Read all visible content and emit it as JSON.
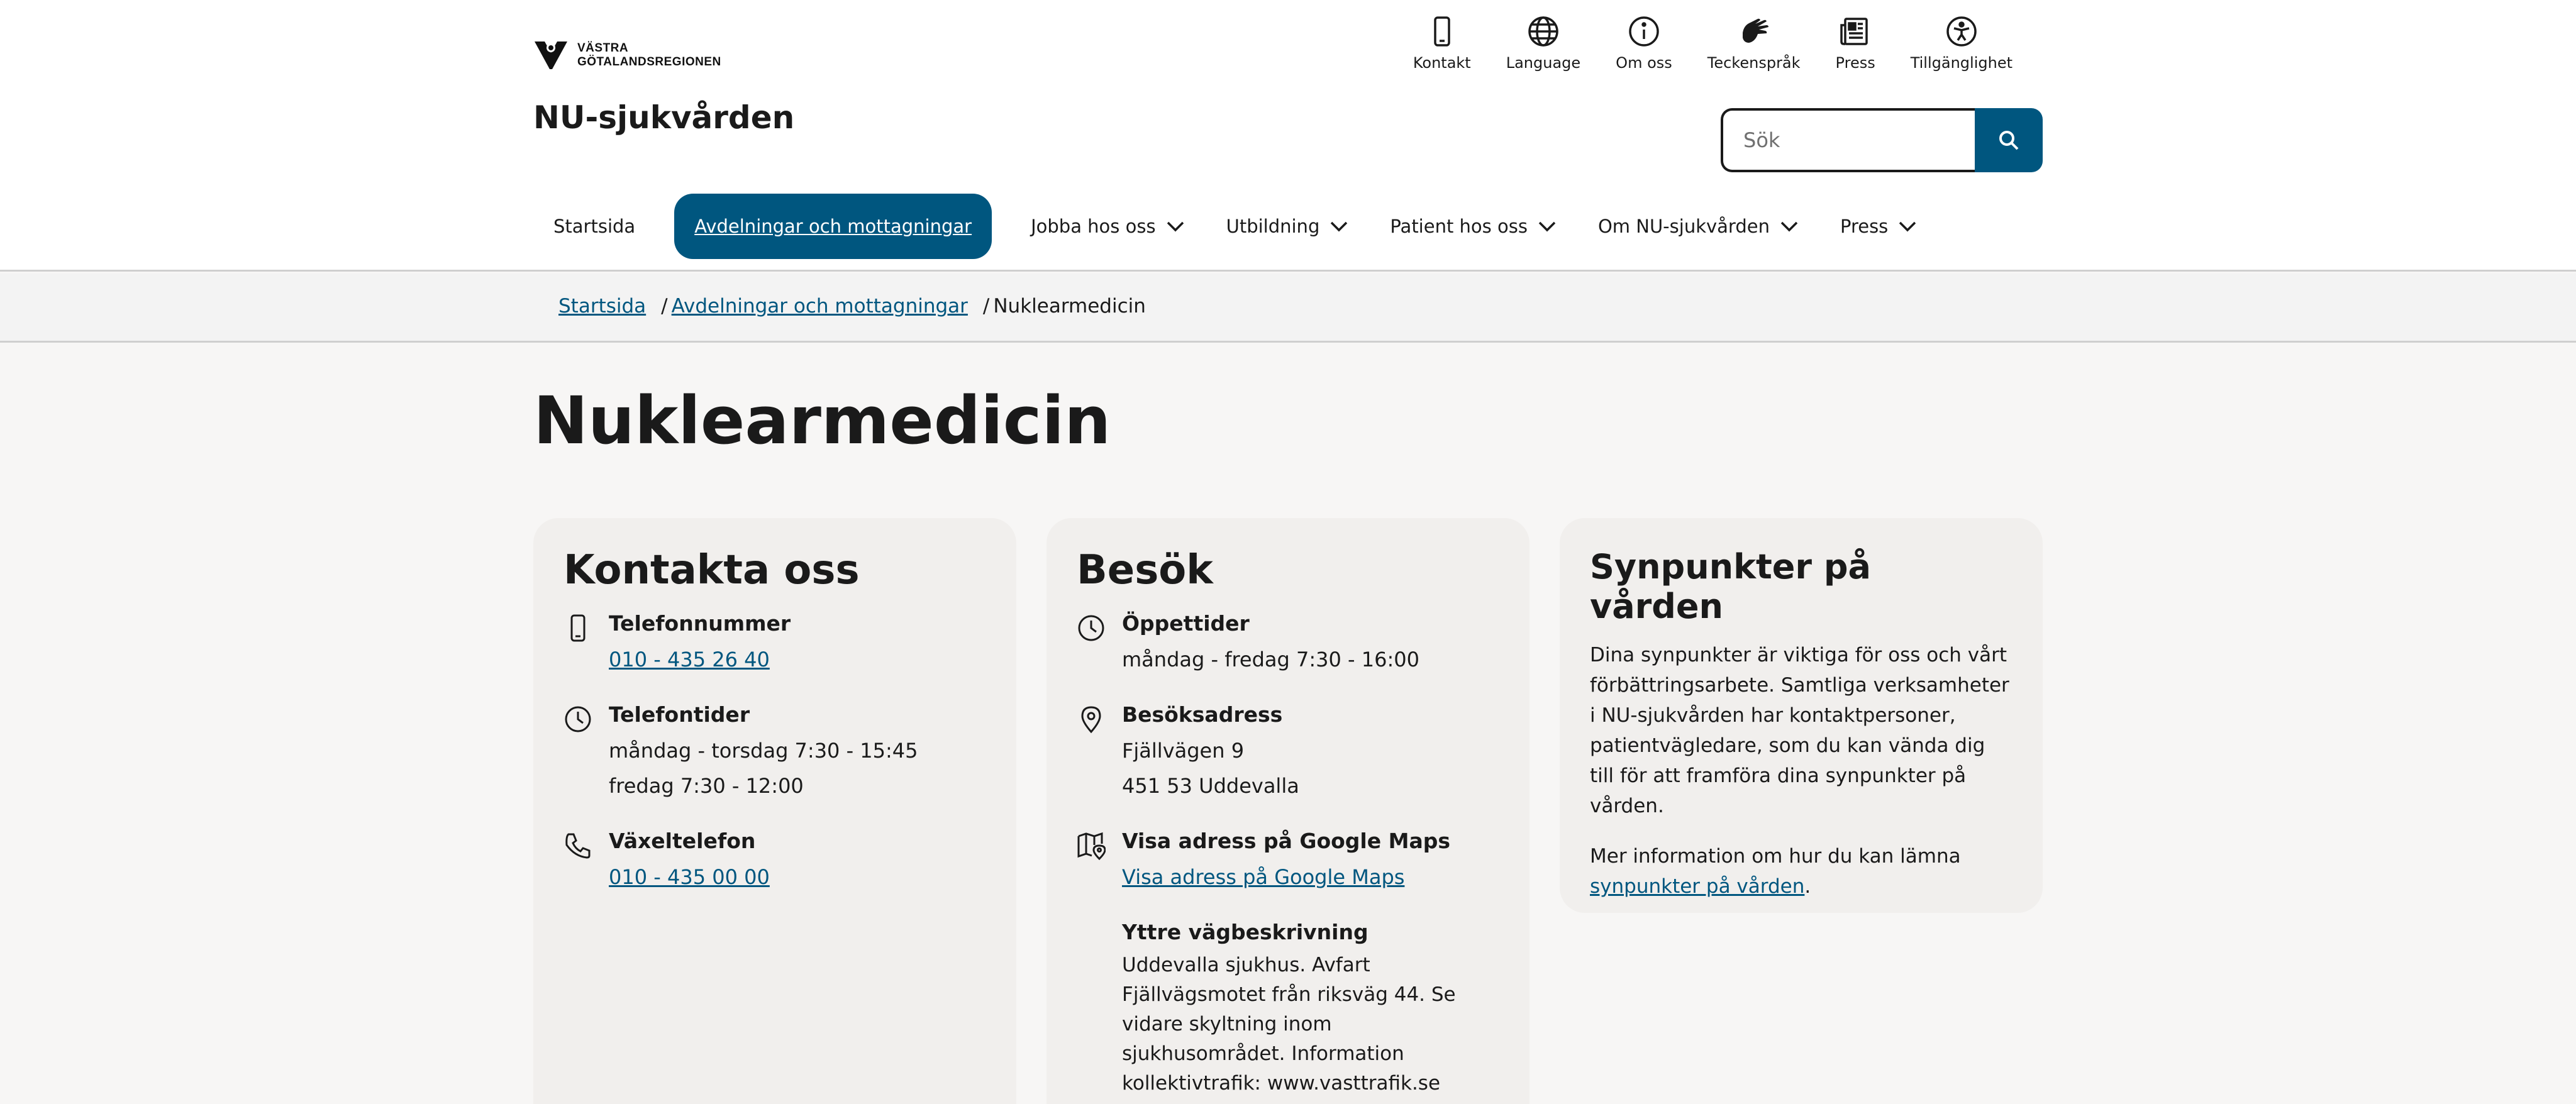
{
  "brand": {
    "logo_line1": "VÄSTRA",
    "logo_line2": "GÖTALANDSREGIONEN",
    "site_title": "NU-sjukvården"
  },
  "top_links": [
    {
      "label": "Kontakt",
      "icon": "mobile-phone-icon"
    },
    {
      "label": "Language",
      "icon": "globe-icon"
    },
    {
      "label": "Om oss",
      "icon": "info-icon"
    },
    {
      "label": "Teckenspråk",
      "icon": "sign-language-icon"
    },
    {
      "label": "Press",
      "icon": "newspaper-icon"
    },
    {
      "label": "Tillgänglighet",
      "icon": "accessibility-icon"
    }
  ],
  "search": {
    "placeholder": "Sök"
  },
  "nav": [
    {
      "label": "Startsida"
    },
    {
      "label": "Avdelningar och mottagningar"
    },
    {
      "label": "Jobba hos oss"
    },
    {
      "label": "Utbildning"
    },
    {
      "label": "Patient hos oss"
    },
    {
      "label": "Om NU-sjukvården"
    },
    {
      "label": "Press"
    }
  ],
  "breadcrumb": {
    "home": "Startsida",
    "section": "Avdelningar och mottagningar",
    "current": "Nuklearmedicin",
    "separator": "/"
  },
  "page_title": "Nuklearmedicin",
  "contact": {
    "title": "Kontakta oss",
    "phone_label": "Telefonnummer",
    "phone_value": "010 - 435 26 40",
    "hours_label": "Telefontider",
    "hours_line1": "måndag - torsdag 7:30 - 15:45",
    "hours_line2": "fredag 7:30 - 12:00",
    "switch_label": "Växeltelefon",
    "switch_value": "010 - 435 00 00"
  },
  "visit": {
    "title": "Besök",
    "open_label": "Öppettider",
    "open_value": "måndag - fredag 7:30 - 16:00",
    "address_label": "Besöksadress",
    "address_line1": "Fjällvägen 9",
    "address_line2": "451 53 Uddevalla",
    "maps_label": "Visa adress på Google Maps",
    "maps_link": "Visa adress på Google Maps",
    "directions_label": "Yttre vägbeskrivning",
    "directions_text": "Uddevalla sjukhus. Avfart Fjällvägsmotet från riksväg 44. Se vidare skyltning inom sjukhusområdet. Information kollektivtrafik: www.vasttrafik.se"
  },
  "feedback": {
    "title": "Synpunkter på vården",
    "paragraph": "Dina synpunkter är viktiga för oss och vårt förbättringsarbete. Samtliga verksamheter i NU-sjukvården har kontaktpersoner, patientvägledare, som du kan vända dig till för att framföra dina synpunkter på vården.",
    "more_prefix": "Mer information om hur du kan lämna",
    "more_link": "synpunkter på vården",
    "more_suffix": "."
  },
  "colors": {
    "accent": "#00567f",
    "card_bg": "#f1efed",
    "page_bg": "#f7f6f5"
  }
}
